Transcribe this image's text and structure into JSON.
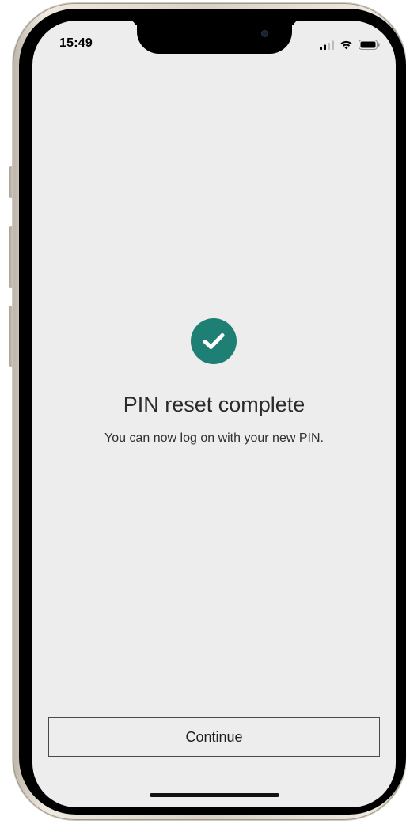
{
  "status_bar": {
    "time": "15:49",
    "icons": [
      "cellular-signal-icon",
      "wifi-icon",
      "battery-icon"
    ]
  },
  "main": {
    "icon": "check-circle-icon",
    "title": "PIN reset complete",
    "message": "You can now log on with your new PIN."
  },
  "actions": {
    "continue_label": "Continue"
  },
  "colors": {
    "accent": "#1e7f74",
    "background": "#ededed",
    "text": "#2b2b2b"
  }
}
